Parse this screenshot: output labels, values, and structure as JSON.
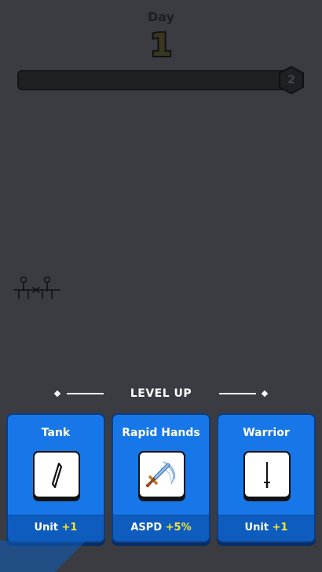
{
  "hud": {
    "day_label": "Day",
    "day_number": "1",
    "progress_fraction": 0.0,
    "next_day": "2"
  },
  "level_up": {
    "title": "LEVEL UP"
  },
  "cards": [
    {
      "title": "Tank",
      "icon": "shield-icon",
      "stat": "Unit",
      "bonus": "+1"
    },
    {
      "title": "Rapid Hands",
      "icon": "sword-swing-icon",
      "stat": "ASPD",
      "bonus": "+5%"
    },
    {
      "title": "Warrior",
      "icon": "sword-icon",
      "stat": "Unit",
      "bonus": "+1"
    }
  ],
  "colors": {
    "background": "#3b3c42",
    "card": "#1877e8",
    "card_footer": "#0f5cbf",
    "bonus": "#f5e73a"
  }
}
